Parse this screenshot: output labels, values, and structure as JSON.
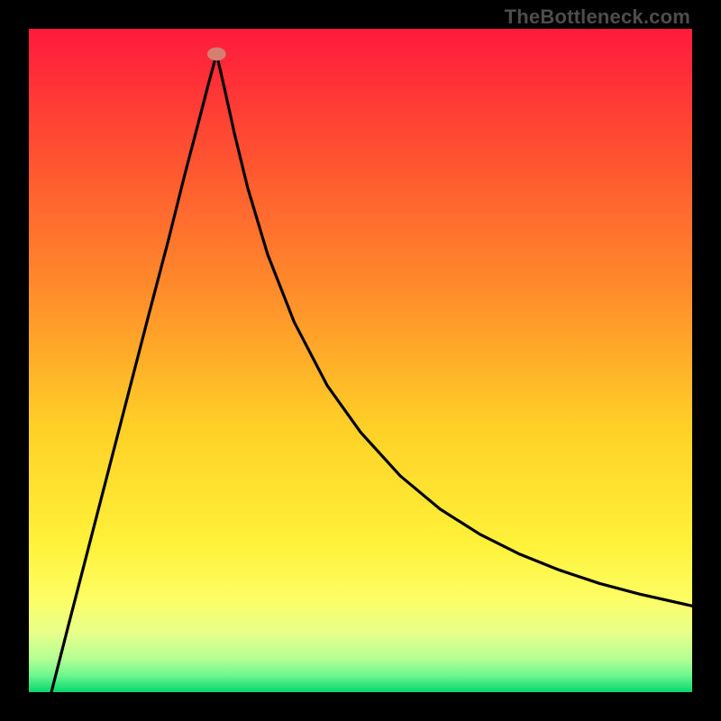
{
  "watermark": "TheBottleneck.com",
  "chart_data": {
    "type": "line",
    "title": "",
    "xlabel": "",
    "ylabel": "",
    "xlim": [
      0,
      1
    ],
    "ylim": [
      0,
      1
    ],
    "legend": false,
    "gradient_stops": [
      {
        "offset": 0.0,
        "color": "#ff1a3c"
      },
      {
        "offset": 0.2,
        "color": "#ff5430"
      },
      {
        "offset": 0.4,
        "color": "#ff8e2a"
      },
      {
        "offset": 0.6,
        "color": "#ffd027"
      },
      {
        "offset": 0.78,
        "color": "#fff23a"
      },
      {
        "offset": 0.86,
        "color": "#fdfe65"
      },
      {
        "offset": 0.91,
        "color": "#e8ff8a"
      },
      {
        "offset": 0.95,
        "color": "#b4ff94"
      },
      {
        "offset": 0.975,
        "color": "#6cf78e"
      },
      {
        "offset": 1.0,
        "color": "#06d66f"
      }
    ],
    "marker": {
      "x": 0.283,
      "y": 0.962,
      "color": "#d57f72",
      "rx": 0.014,
      "ry": 0.01
    },
    "series": [
      {
        "name": "curve",
        "x": [
          0.034,
          0.06,
          0.09,
          0.12,
          0.15,
          0.18,
          0.21,
          0.235,
          0.255,
          0.27,
          0.283,
          0.295,
          0.31,
          0.33,
          0.36,
          0.4,
          0.45,
          0.5,
          0.56,
          0.62,
          0.68,
          0.74,
          0.8,
          0.86,
          0.92,
          1.0
        ],
        "y": [
          0.0,
          0.102,
          0.218,
          0.334,
          0.45,
          0.566,
          0.68,
          0.78,
          0.856,
          0.914,
          0.962,
          0.91,
          0.842,
          0.76,
          0.66,
          0.558,
          0.462,
          0.392,
          0.326,
          0.276,
          0.238,
          0.208,
          0.184,
          0.164,
          0.148,
          0.13
        ]
      }
    ]
  }
}
